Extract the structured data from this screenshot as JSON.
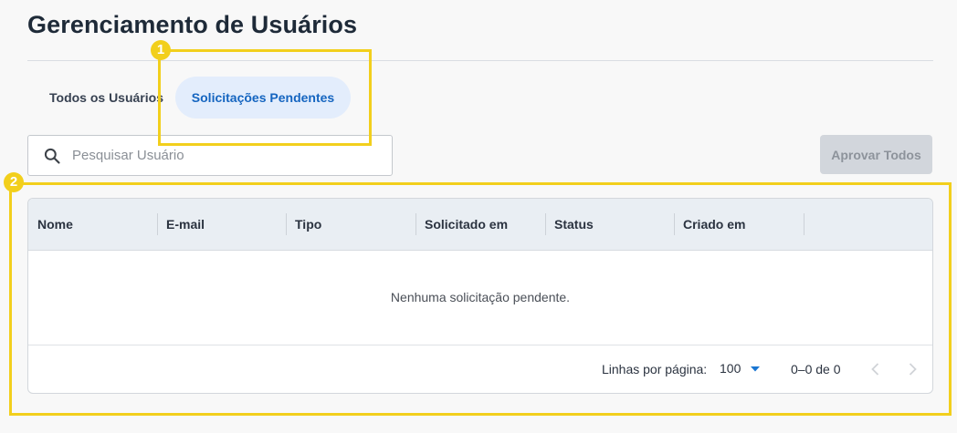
{
  "page": {
    "title": "Gerenciamento de Usuários"
  },
  "tabs": [
    {
      "label": "Todos os Usuários",
      "active": false
    },
    {
      "label": "Solicitações Pendentes",
      "active": true
    }
  ],
  "search": {
    "placeholder": "Pesquisar Usuário",
    "value": ""
  },
  "actions": {
    "approve_all_label": "Aprovar Todos",
    "approve_all_disabled": true
  },
  "table": {
    "columns": [
      "Nome",
      "E-mail",
      "Tipo",
      "Solicitado em",
      "Status",
      "Criado em"
    ],
    "rows": [],
    "empty_message": "Nenhuma solicitação pendente."
  },
  "pagination": {
    "rows_per_page_label": "Linhas por página:",
    "rows_per_page": "100",
    "range": "0–0 de 0"
  },
  "annotations": [
    {
      "number": "1"
    },
    {
      "number": "2"
    }
  ],
  "colors": {
    "accent": "#1565c0",
    "active_tab_bg": "#e3edfc",
    "highlight": "#f2cf1c",
    "disabled_button": "#d2d6dc"
  }
}
